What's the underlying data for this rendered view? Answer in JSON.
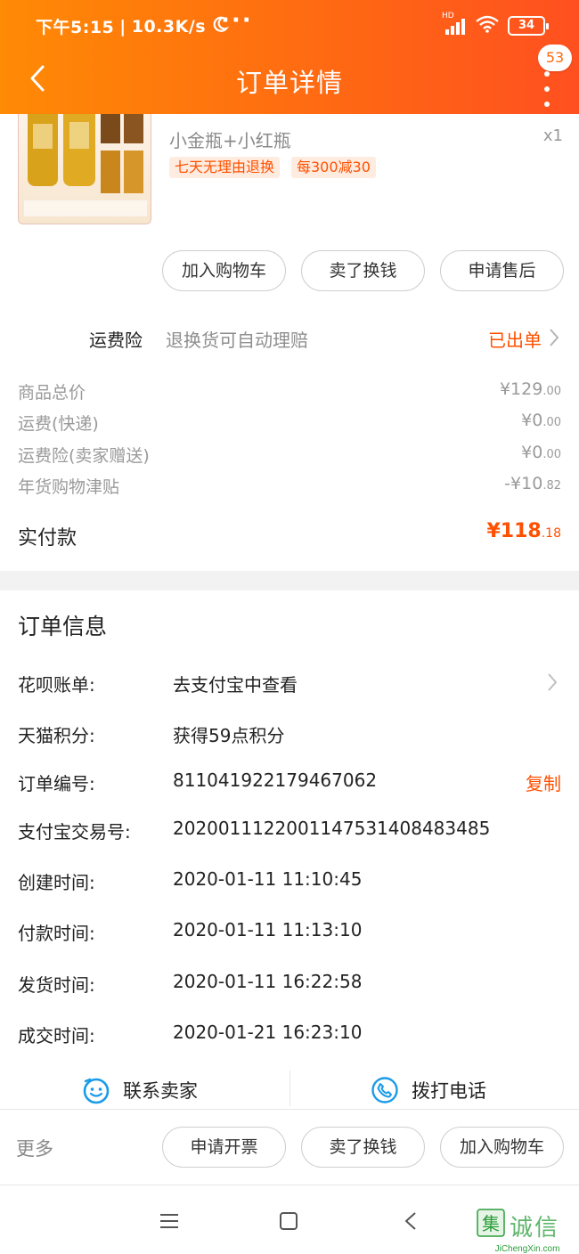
{
  "status_bar": {
    "time": "下午5:15",
    "speed": "10.3K/s",
    "dots": "···",
    "network": "HD",
    "battery": "34"
  },
  "nav": {
    "title": "订单详情",
    "badge": "53"
  },
  "product": {
    "sku": "小金瓶+小红瓶",
    "qty": "x1",
    "tags": [
      "七天无理由退换",
      "每300减30"
    ],
    "actions": [
      "加入购物车",
      "卖了换钱",
      "申请售后"
    ]
  },
  "insurance": {
    "label": "运费险",
    "desc": "退换货可自动理赔",
    "status": "已出单"
  },
  "price_breakdown": {
    "rows": [
      {
        "label": "商品总价",
        "prefix": "¥",
        "int": "129",
        "dec": ".00"
      },
      {
        "label": "运费(快递)",
        "prefix": "¥",
        "int": "0",
        "dec": ".00"
      },
      {
        "label": "运费险(卖家赠送)",
        "prefix": "¥",
        "int": "0",
        "dec": ".00"
      },
      {
        "label": "年货购物津贴",
        "prefix": "-¥",
        "int": "10",
        "dec": ".82"
      }
    ],
    "total_label": "实付款",
    "total_prefix": "¥",
    "total_int": "118",
    "total_dec": ".18"
  },
  "order_info": {
    "title": "订单信息",
    "rows": [
      {
        "label": "花呗账单:",
        "value": "去支付宝中查看"
      },
      {
        "label": "天猫积分:",
        "value": "获得59点积分"
      },
      {
        "label": "订单编号:",
        "value": "811041922179467062",
        "action": "复制"
      },
      {
        "label": "支付宝交易号:",
        "value": "2020011122001147531408483485"
      },
      {
        "label": "创建时间:",
        "value": "2020-01-11 11:10:45"
      },
      {
        "label": "付款时间:",
        "value": "2020-01-11 11:13:10"
      },
      {
        "label": "发货时间:",
        "value": "2020-01-11 16:22:58"
      },
      {
        "label": "成交时间:",
        "value": "2020-01-21 16:23:10"
      }
    ]
  },
  "contact": {
    "seller": "联系卖家",
    "phone": "拨打电话"
  },
  "bottom_bar": {
    "more": "更多",
    "buttons": [
      "申请开票",
      "卖了换钱",
      "加入购物车"
    ]
  },
  "watermark": {
    "chars": "集诚信",
    "url": "JiChengXin.com"
  },
  "colors": {
    "accent": "#ff5000",
    "header_start": "#ff8a05",
    "header_end": "#ff5020",
    "muted_text": "#9a9a9a"
  }
}
